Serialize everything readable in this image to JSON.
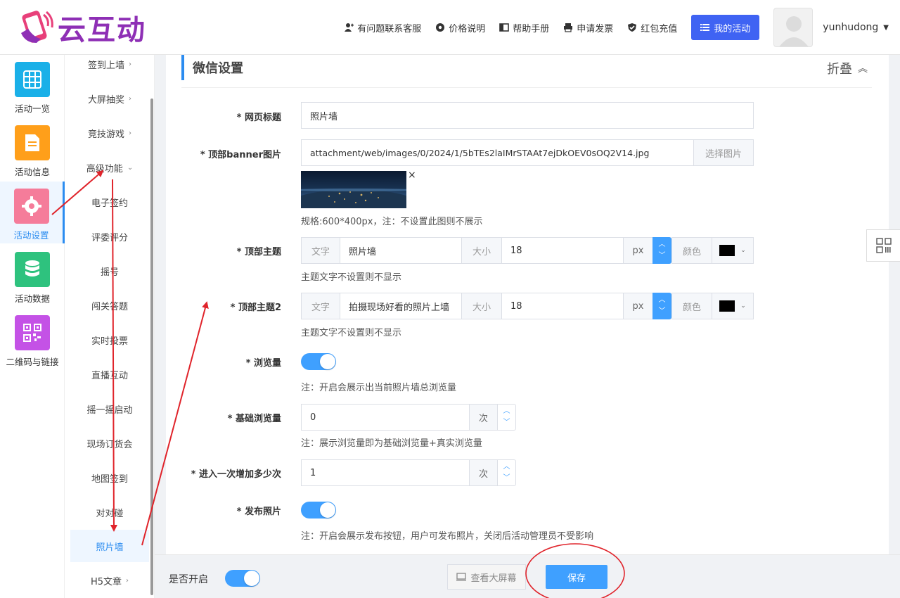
{
  "brand": {
    "name": "云互动"
  },
  "header": {
    "links": [
      {
        "label": "有问题联系客服",
        "icon": "user-plus-icon"
      },
      {
        "label": "价格说明",
        "icon": "gear-icon"
      },
      {
        "label": "帮助手册",
        "icon": "book-icon"
      },
      {
        "label": "申请发票",
        "icon": "printer-icon"
      },
      {
        "label": "红包充值",
        "icon": "shield-check-icon"
      }
    ],
    "my_activity": "我的活动",
    "username": "yunhudong"
  },
  "leftbar": [
    {
      "label": "活动一览",
      "icon": "grid-icon",
      "color": "#1ab0e8"
    },
    {
      "label": "活动信息",
      "icon": "document-icon",
      "color": "#ff9f1a"
    },
    {
      "label": "活动设置",
      "icon": "gear-icon",
      "color": "#f57c9a"
    },
    {
      "label": "活动数据",
      "icon": "database-icon",
      "color": "#2ec27e"
    },
    {
      "label": "二维码与链接",
      "icon": "qrcode-icon",
      "color": "#c452e6"
    }
  ],
  "subbar": [
    {
      "label": "签到上墙",
      "chev": "›"
    },
    {
      "label": "大屏抽奖",
      "chev": "›"
    },
    {
      "label": "竞技游戏",
      "chev": "›"
    },
    {
      "label": "高级功能",
      "chev": "⌄"
    },
    {
      "label": "电子签约",
      "chev": ""
    },
    {
      "label": "评委评分",
      "chev": ""
    },
    {
      "label": "摇号",
      "chev": ""
    },
    {
      "label": "闯关答题",
      "chev": ""
    },
    {
      "label": "实时投票",
      "chev": ""
    },
    {
      "label": "直播互动",
      "chev": ""
    },
    {
      "label": "摇一摇启动",
      "chev": ""
    },
    {
      "label": "现场订货会",
      "chev": ""
    },
    {
      "label": "地图签到",
      "chev": ""
    },
    {
      "label": "对对碰",
      "chev": ""
    },
    {
      "label": "照片墙",
      "chev": ""
    },
    {
      "label": "H5文章",
      "chev": "›"
    }
  ],
  "section": {
    "title": "微信设置",
    "fold": "折叠"
  },
  "form": {
    "page_title": {
      "label": "* 网页标题",
      "value": "照片墙"
    },
    "banner": {
      "label": "* 顶部banner图片",
      "value": "attachment/web/images/0/2024/1/5bTEs2laIMrSTAAt7ejDkOEV0sOQ2V14.jpg",
      "button": "选择图片",
      "remove": "×",
      "hint": "规格:600*400px，注：不设置此图则不展示"
    },
    "theme1": {
      "label": "* 顶部主题",
      "text_addon": "文字",
      "text": "照片墙",
      "size_addon": "大小",
      "size": "18",
      "unit": "px",
      "color_addon": "颜色",
      "hint": "主题文字不设置则不显示"
    },
    "theme2": {
      "label": "* 顶部主题2",
      "text_addon": "文字",
      "text": "拍摄现场好看的照片上墙",
      "size_addon": "大小",
      "size": "18",
      "unit": "px",
      "color_addon": "颜色",
      "hint": "主题文字不设置则不显示"
    },
    "views": {
      "label": "* 浏览量",
      "hint": "注：开启会展示出当前照片墙总浏览量"
    },
    "base_views": {
      "label": "* 基础浏览量",
      "value": "0",
      "unit": "次",
      "hint": "注：展示浏览量即为基础浏览量+真实浏览量"
    },
    "increment": {
      "label": "* 进入一次增加多少次",
      "value": "1",
      "unit": "次"
    },
    "publish": {
      "label": "* 发布照片",
      "hint": "注：开启会展示发布按钮，用户可发布照片，关闭后活动管理员不受影响"
    }
  },
  "footer": {
    "enable": "是否开启",
    "view_screen": "查看大屏幕",
    "save": "保存"
  },
  "colors": {
    "accent": "#2b8cf0",
    "toggle": "#3fa0ff",
    "primary": "#3f63f3",
    "annotation": "#e0242b"
  }
}
